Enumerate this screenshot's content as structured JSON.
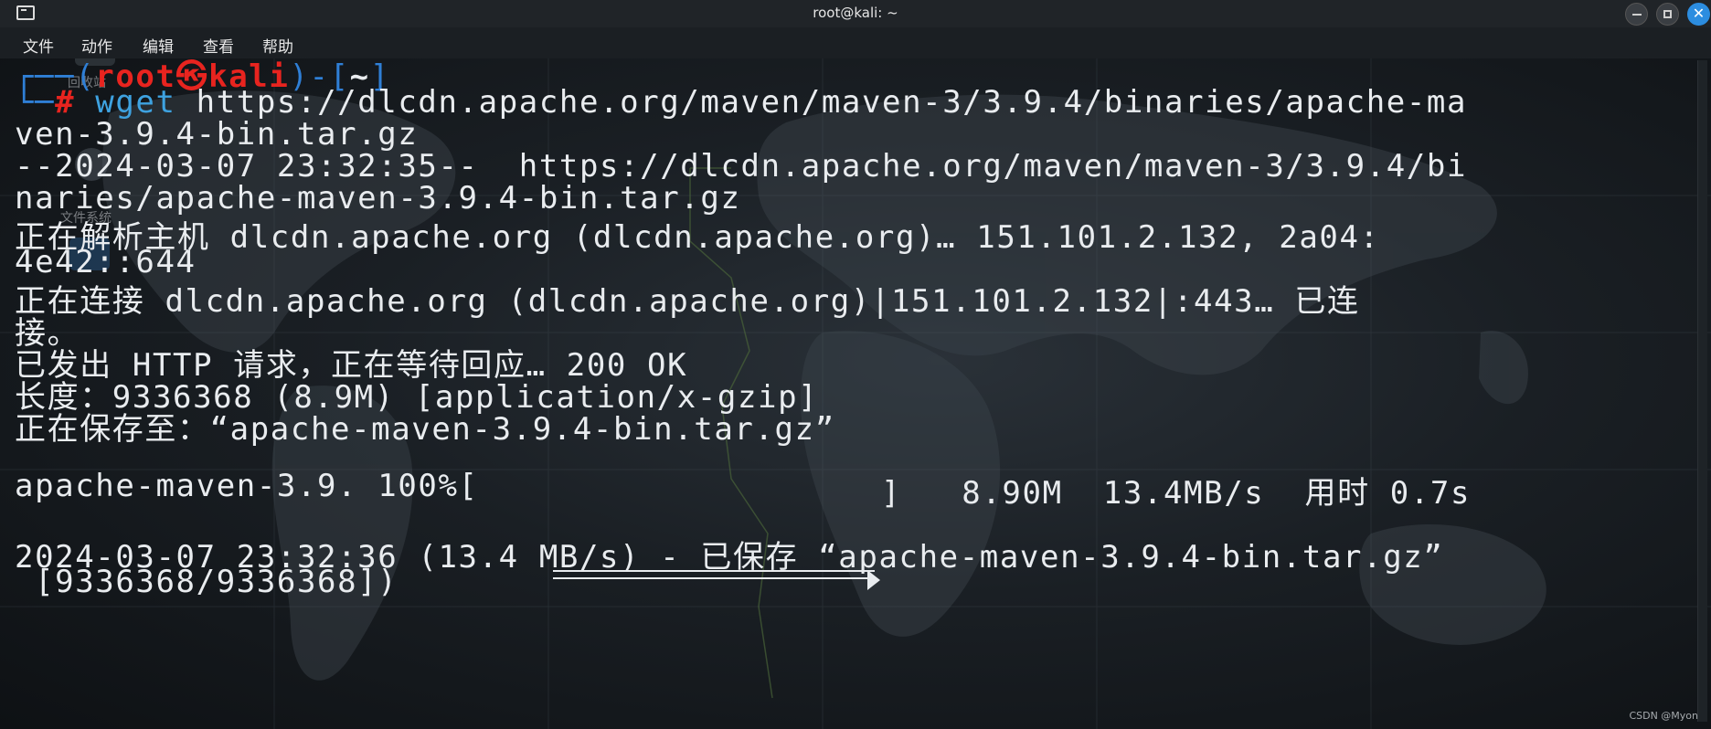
{
  "window": {
    "title": "root@kali: ~",
    "close_glyph": "✕"
  },
  "menu": {
    "items": [
      "文件",
      "动作",
      "编辑",
      "查看",
      "帮助"
    ]
  },
  "desktop": {
    "icons": [
      {
        "label": "回收站",
        "icon": "trash-icon"
      },
      {
        "label": "文件系统",
        "icon": "drive-icon"
      },
      {
        "label": "",
        "icon": "home-folder-icon"
      }
    ]
  },
  "prompt": {
    "frame_top": "┌──(",
    "user_host": "root㉿kali",
    "frame_mid": ")-[",
    "cwd": "~",
    "frame_end": "]",
    "frame_bottom": "└─",
    "hash": "#",
    "command": "wget",
    "args": "https://dlcdn.apache.org/maven/maven-3/3.9.4/binaries/apache-ma"
  },
  "output": {
    "lines": [
      "ven-3.9.4-bin.tar.gz",
      "--2024-03-07 23:32:35--  https://dlcdn.apache.org/maven/maven-3/3.9.4/bi",
      "naries/apache-maven-3.9.4-bin.tar.gz",
      "正在解析主机 dlcdn.apache.org (dlcdn.apache.org)… 151.101.2.132, 2a04:",
      "4e42::644",
      "正在连接 dlcdn.apache.org (dlcdn.apache.org)|151.101.2.132|:443… 已连",
      "接。",
      "已发出 HTTP 请求，正在等待回应… 200 OK",
      "长度：9336368 (8.9M) [application/x-gzip]",
      "正在保存至：“apache-maven-3.9.4-bin.tar.gz”"
    ],
    "progress": {
      "name": "apache-maven-3.9.",
      "percent_text": "100%[",
      "percent": 100,
      "bar_end": "]",
      "size": "8.90M",
      "speed": "13.4MB/s",
      "time_label": "用时",
      "time": "0.7s"
    },
    "saved_line": "2024-03-07 23:32:36 (13.4 MB/s) - 已保存 “apache-maven-3.9.4-bin.tar.gz”",
    "saved_size": " [9336368/9336368])"
  },
  "watermark": "CSDN @Myon⁠‌",
  "colors": {
    "prompt_frame": "#2f7fd6",
    "prompt_user": "#e8241f",
    "command": "#3ea2e0",
    "text": "#e9ecef",
    "close_button": "#2c8de0"
  }
}
